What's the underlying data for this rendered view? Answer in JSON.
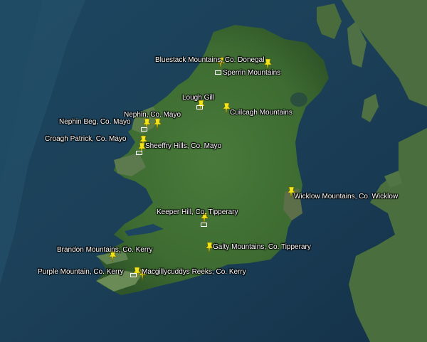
{
  "map": {
    "colors": {
      "sea_deep": "#1a3b52",
      "sea_shallow": "#234a63",
      "land_green": "#3e6a34",
      "land_dark": "#2f5528",
      "uk_land": "#446b3a",
      "pin_yellow": "#f2e41a",
      "label_text": "#ffffff"
    },
    "icon": "pushpin-icon",
    "placemarks": [
      {
        "id": "bluestack",
        "label": "Bluestack Mountains, Co. Donegal"
      },
      {
        "id": "sperrin",
        "label": "Sperrin Mountains"
      },
      {
        "id": "lough-gill",
        "label": "Lough Gill"
      },
      {
        "id": "cuilcagh",
        "label": "Cuilcagh Mountains"
      },
      {
        "id": "nephin",
        "label": "Nephin, Co. Mayo"
      },
      {
        "id": "nephin-beg",
        "label": "Nephin Beg, Co. Mayo"
      },
      {
        "id": "croagh-patrick",
        "label": "Croagh Patrick, Co. Mayo"
      },
      {
        "id": "sheeffry",
        "label": "Sheeffry Hills, Co. Mayo"
      },
      {
        "id": "wicklow",
        "label": "Wicklow Mountains, Co. Wicklow"
      },
      {
        "id": "keeper-hill",
        "label": "Keeper Hill, Co. Tipperary"
      },
      {
        "id": "galty",
        "label": "Galty Mountains, Co. Tipperary"
      },
      {
        "id": "brandon",
        "label": "Brandon Mountains, Co. Kerry"
      },
      {
        "id": "purple",
        "label": "Purple Mountain, Co. Kerry"
      },
      {
        "id": "macgillycuddy",
        "label": "Macgillycuddys Reeks, Co. Kerry"
      }
    ]
  }
}
